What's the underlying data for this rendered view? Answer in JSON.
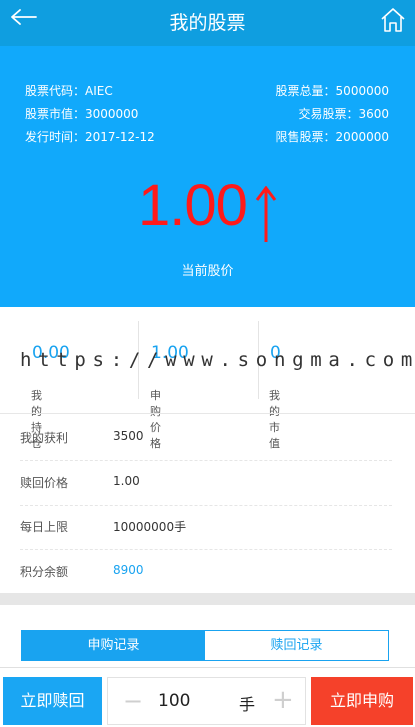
{
  "header": {
    "title": "我的股票"
  },
  "info": {
    "left": [
      {
        "label": "股票代码：AIEC"
      },
      {
        "label": "股票市值：3000000"
      },
      {
        "label": "发行时间：2017-12-12"
      }
    ],
    "right": [
      {
        "label": "股票总量：5000000"
      },
      {
        "label": "交易股票：3600"
      },
      {
        "label": "限售股票：2000000"
      }
    ]
  },
  "price": {
    "value": "1.00",
    "label": "当前股价",
    "trend": "up-arrow",
    "color": "#ff1a1a"
  },
  "stats": [
    {
      "value": "0.00",
      "label": "我的持仓"
    },
    {
      "value": "1.00",
      "label": "申购价格"
    },
    {
      "value": "0",
      "label": "我的市值"
    }
  ],
  "watermark": "https://www.songma.com",
  "details": [
    {
      "key": "我的获利",
      "value": "3500"
    },
    {
      "key": "赎回价格",
      "value": "1.00"
    },
    {
      "key": "每日上限",
      "value": "10000000手"
    },
    {
      "key": "积分余额",
      "value": "8900"
    }
  ],
  "tabs": [
    {
      "label": "申购记录",
      "active": true
    },
    {
      "label": "赎回记录",
      "active": false
    }
  ],
  "bottom": {
    "redeem_label": "立即赎回",
    "minus": "−",
    "quantity": "100",
    "unit": "手",
    "plus": "+",
    "buy_label": "立即申购"
  },
  "colors": {
    "header": "#0f9ee0",
    "hero": "#11a9fb",
    "accent": "#19a3f0",
    "buy": "#f5412a"
  }
}
